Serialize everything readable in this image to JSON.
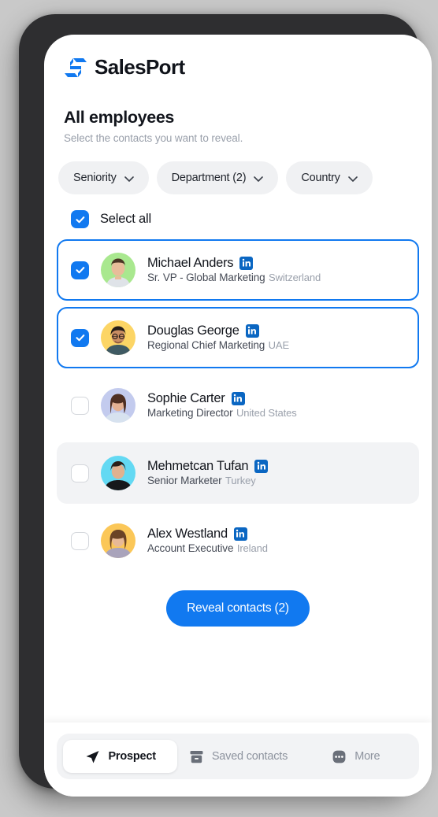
{
  "brand": {
    "name": "SalesPort",
    "logo_icon": "exchange-arrows-icon",
    "accent_color": "#1179f0",
    "logo_color": "#1179f0"
  },
  "header": {
    "title": "All employees",
    "subtitle": "Select the contacts you want to reveal."
  },
  "filters": [
    {
      "label": "Seniority",
      "icon": "chevron-down-icon"
    },
    {
      "label": "Department (2)",
      "icon": "chevron-down-icon"
    },
    {
      "label": "Country",
      "icon": "chevron-down-icon"
    }
  ],
  "select_all": {
    "label": "Select all",
    "checked": true
  },
  "contacts": [
    {
      "name": "Michael Anders",
      "role": "Sr. VP - Global Marketing",
      "country": "Switzerland",
      "checked": true,
      "selected": true,
      "hovered": false,
      "linkedin_icon": "linkedin-icon",
      "avatar_bg": "#a9e88f",
      "avatar_skin": "#e8bd9a",
      "avatar_hair": "#4a3524",
      "avatar_shirt": "#dfe3e8"
    },
    {
      "name": "Douglas George",
      "role": "Regional Chief Marketing",
      "country": "UAE",
      "checked": true,
      "selected": true,
      "hovered": false,
      "linkedin_icon": "linkedin-icon",
      "avatar_bg": "#fcd565",
      "avatar_skin": "#c98d63",
      "avatar_hair": "#231c18",
      "avatar_shirt": "#3f5a63"
    },
    {
      "name": "Sophie Carter",
      "role": "Marketing Director",
      "country": "United States",
      "checked": false,
      "selected": false,
      "hovered": false,
      "linkedin_icon": "linkedin-icon",
      "avatar_bg": "#c3cbee",
      "avatar_skin": "#e3b193",
      "avatar_hair": "#4e2f22",
      "avatar_shirt": "#d7e2ef"
    },
    {
      "name": "Mehmetcan Tufan",
      "role": "Senior Marketer",
      "country": "Turkey",
      "checked": false,
      "selected": false,
      "hovered": true,
      "linkedin_icon": "linkedin-icon",
      "avatar_bg": "#63d9f3",
      "avatar_skin": "#e0b18f",
      "avatar_hair": "#2b1f18",
      "avatar_shirt": "#17181b"
    },
    {
      "name": "Alex Westland",
      "role": "Account Executive",
      "country": "Ireland",
      "checked": false,
      "selected": false,
      "hovered": false,
      "linkedin_icon": "linkedin-icon",
      "avatar_bg": "#fbc758",
      "avatar_skin": "#e8b996",
      "avatar_hair": "#6b4326",
      "avatar_shirt": "#a9a3bb"
    }
  ],
  "cta": {
    "label": "Reveal contacts (2)",
    "count": 2
  },
  "bottom_nav": {
    "items": [
      {
        "label": "Prospect",
        "icon": "paper-plane-icon",
        "active": true
      },
      {
        "label": "Saved contacts",
        "icon": "archive-box-icon",
        "active": false
      },
      {
        "label": "More",
        "icon": "ellipsis-icon",
        "active": false
      }
    ]
  }
}
